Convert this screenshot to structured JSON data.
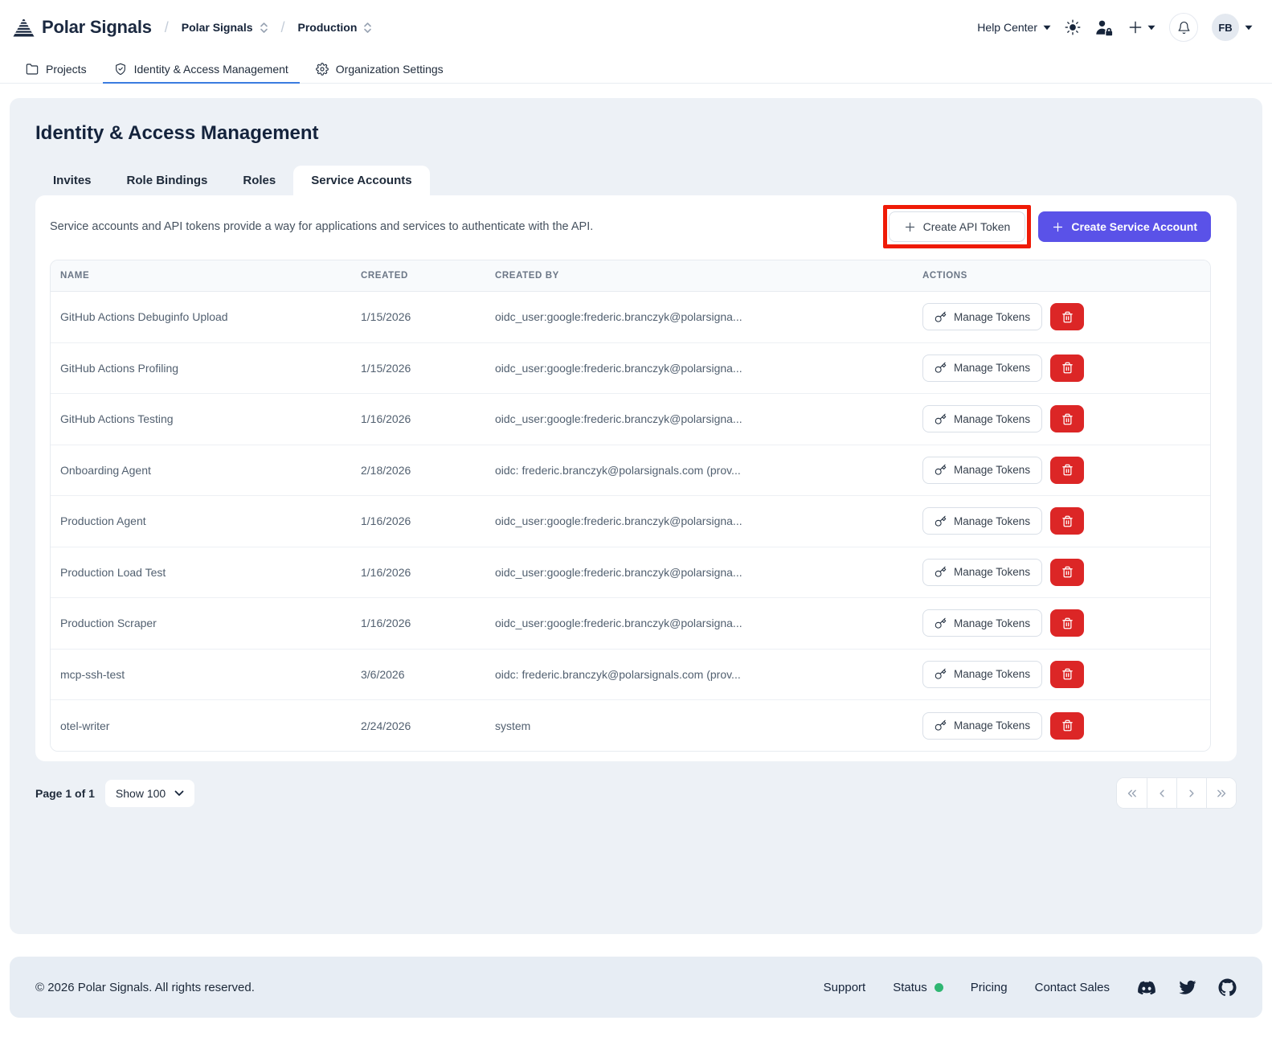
{
  "header": {
    "logo_text": "Polar Signals",
    "breadcrumbs": [
      {
        "label": "Polar Signals"
      },
      {
        "label": "Production"
      }
    ],
    "help_center_label": "Help Center",
    "avatar_initials": "FB"
  },
  "nav": {
    "items": [
      {
        "label": "Projects",
        "icon": "folder-icon",
        "active": false
      },
      {
        "label": "Identity & Access Management",
        "icon": "shield-check-icon",
        "active": true
      },
      {
        "label": "Organization Settings",
        "icon": "gear-icon",
        "active": false
      }
    ]
  },
  "page": {
    "title": "Identity & Access Management",
    "tabs": [
      {
        "label": "Invites"
      },
      {
        "label": "Role Bindings"
      },
      {
        "label": "Roles"
      },
      {
        "label": "Service Accounts"
      }
    ],
    "active_tab": "Service Accounts",
    "description": "Service accounts and API tokens provide a way for applications and services to authenticate with the API.",
    "create_api_token_label": "Create API Token",
    "create_service_account_label": "Create Service Account"
  },
  "table": {
    "columns": [
      "NAME",
      "CREATED",
      "CREATED BY",
      "ACTIONS"
    ],
    "manage_tokens_label": "Manage Tokens",
    "rows": [
      {
        "name": "GitHub Actions Debuginfo Upload",
        "created": "1/15/2026",
        "created_by": "oidc_user:google:frederic.branczyk@polarsigna..."
      },
      {
        "name": "GitHub Actions Profiling",
        "created": "1/15/2026",
        "created_by": "oidc_user:google:frederic.branczyk@polarsigna..."
      },
      {
        "name": "GitHub Actions Testing",
        "created": "1/16/2026",
        "created_by": "oidc_user:google:frederic.branczyk@polarsigna..."
      },
      {
        "name": "Onboarding Agent",
        "created": "2/18/2026",
        "created_by": "oidc: frederic.branczyk@polarsignals.com (prov..."
      },
      {
        "name": "Production Agent",
        "created": "1/16/2026",
        "created_by": "oidc_user:google:frederic.branczyk@polarsigna..."
      },
      {
        "name": "Production Load Test",
        "created": "1/16/2026",
        "created_by": "oidc_user:google:frederic.branczyk@polarsigna..."
      },
      {
        "name": "Production Scraper",
        "created": "1/16/2026",
        "created_by": "oidc_user:google:frederic.branczyk@polarsigna..."
      },
      {
        "name": "mcp-ssh-test",
        "created": "3/6/2026",
        "created_by": "oidc: frederic.branczyk@polarsignals.com (prov..."
      },
      {
        "name": "otel-writer",
        "created": "2/24/2026",
        "created_by": "system"
      }
    ]
  },
  "pagination": {
    "page_label": "Page 1 of 1",
    "show_label": "Show 100"
  },
  "footer": {
    "copyright": "© 2026 Polar Signals. All rights reserved.",
    "links": [
      "Support",
      "Status",
      "Pricing",
      "Contact Sales"
    ],
    "social_icons": [
      "discord-icon",
      "twitter-icon",
      "github-icon"
    ]
  },
  "colors": {
    "accent_indigo": "#5a52e8",
    "danger_red": "#dc2626",
    "annotation_red": "#ef1b07",
    "active_nav_underline": "#3b7ce0",
    "status_green": "#2fb672",
    "card_bg": "#edf1f6",
    "footer_bg": "#e7edf4"
  }
}
